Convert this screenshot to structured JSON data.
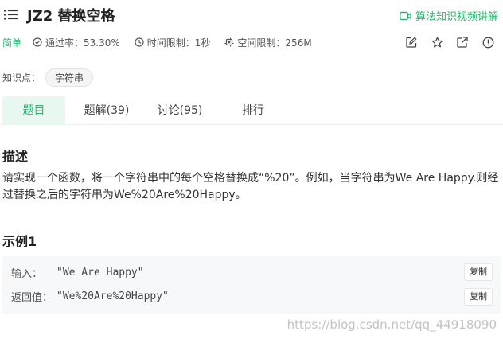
{
  "header": {
    "title": "JZ2  替换空格",
    "video_link": "算法知识视频讲解"
  },
  "meta": {
    "difficulty": "简单",
    "pass_rate": "通过率：53.30%",
    "time_limit": "时间限制：1秒",
    "space_limit": "空间限制：256M"
  },
  "knowledge": {
    "label": "知识点：",
    "tag": "字符串"
  },
  "tabs": [
    {
      "label": "题目"
    },
    {
      "label": "题解(39)"
    },
    {
      "label": "讨论(95)"
    },
    {
      "label": "排行"
    }
  ],
  "description": {
    "heading": "描述",
    "text": "请实现一个函数，将一个字符串中的每个空格替换成“%20”。例如，当字符串为We Are Happy.则经过替换之后的字符串为We%20Are%20Happy。"
  },
  "example": {
    "heading": "示例1",
    "input_label": "输入：",
    "input_value": "\"We Are Happy\"",
    "output_label": "返回值：",
    "output_value": "\"We%20Are%20Happy\"",
    "copy_label": "复制"
  },
  "watermark": "https://blog.csdn.net/qq_44918090",
  "colors": {
    "accent": "#2db573",
    "tab_active_bg": "#e9f7f1"
  }
}
